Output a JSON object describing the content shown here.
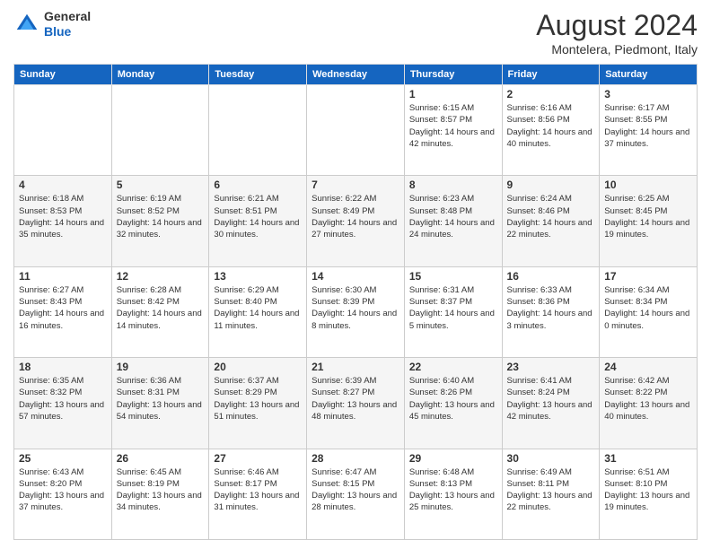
{
  "logo": {
    "line1": "General",
    "line2": "Blue"
  },
  "header": {
    "title": "August 2024",
    "subtitle": "Montelera, Piedmont, Italy"
  },
  "days_of_week": [
    "Sunday",
    "Monday",
    "Tuesday",
    "Wednesday",
    "Thursday",
    "Friday",
    "Saturday"
  ],
  "weeks": [
    [
      {
        "day": "",
        "info": ""
      },
      {
        "day": "",
        "info": ""
      },
      {
        "day": "",
        "info": ""
      },
      {
        "day": "",
        "info": ""
      },
      {
        "day": "1",
        "info": "Sunrise: 6:15 AM\nSunset: 8:57 PM\nDaylight: 14 hours and 42 minutes."
      },
      {
        "day": "2",
        "info": "Sunrise: 6:16 AM\nSunset: 8:56 PM\nDaylight: 14 hours and 40 minutes."
      },
      {
        "day": "3",
        "info": "Sunrise: 6:17 AM\nSunset: 8:55 PM\nDaylight: 14 hours and 37 minutes."
      }
    ],
    [
      {
        "day": "4",
        "info": "Sunrise: 6:18 AM\nSunset: 8:53 PM\nDaylight: 14 hours and 35 minutes."
      },
      {
        "day": "5",
        "info": "Sunrise: 6:19 AM\nSunset: 8:52 PM\nDaylight: 14 hours and 32 minutes."
      },
      {
        "day": "6",
        "info": "Sunrise: 6:21 AM\nSunset: 8:51 PM\nDaylight: 14 hours and 30 minutes."
      },
      {
        "day": "7",
        "info": "Sunrise: 6:22 AM\nSunset: 8:49 PM\nDaylight: 14 hours and 27 minutes."
      },
      {
        "day": "8",
        "info": "Sunrise: 6:23 AM\nSunset: 8:48 PM\nDaylight: 14 hours and 24 minutes."
      },
      {
        "day": "9",
        "info": "Sunrise: 6:24 AM\nSunset: 8:46 PM\nDaylight: 14 hours and 22 minutes."
      },
      {
        "day": "10",
        "info": "Sunrise: 6:25 AM\nSunset: 8:45 PM\nDaylight: 14 hours and 19 minutes."
      }
    ],
    [
      {
        "day": "11",
        "info": "Sunrise: 6:27 AM\nSunset: 8:43 PM\nDaylight: 14 hours and 16 minutes."
      },
      {
        "day": "12",
        "info": "Sunrise: 6:28 AM\nSunset: 8:42 PM\nDaylight: 14 hours and 14 minutes."
      },
      {
        "day": "13",
        "info": "Sunrise: 6:29 AM\nSunset: 8:40 PM\nDaylight: 14 hours and 11 minutes."
      },
      {
        "day": "14",
        "info": "Sunrise: 6:30 AM\nSunset: 8:39 PM\nDaylight: 14 hours and 8 minutes."
      },
      {
        "day": "15",
        "info": "Sunrise: 6:31 AM\nSunset: 8:37 PM\nDaylight: 14 hours and 5 minutes."
      },
      {
        "day": "16",
        "info": "Sunrise: 6:33 AM\nSunset: 8:36 PM\nDaylight: 14 hours and 3 minutes."
      },
      {
        "day": "17",
        "info": "Sunrise: 6:34 AM\nSunset: 8:34 PM\nDaylight: 14 hours and 0 minutes."
      }
    ],
    [
      {
        "day": "18",
        "info": "Sunrise: 6:35 AM\nSunset: 8:32 PM\nDaylight: 13 hours and 57 minutes."
      },
      {
        "day": "19",
        "info": "Sunrise: 6:36 AM\nSunset: 8:31 PM\nDaylight: 13 hours and 54 minutes."
      },
      {
        "day": "20",
        "info": "Sunrise: 6:37 AM\nSunset: 8:29 PM\nDaylight: 13 hours and 51 minutes."
      },
      {
        "day": "21",
        "info": "Sunrise: 6:39 AM\nSunset: 8:27 PM\nDaylight: 13 hours and 48 minutes."
      },
      {
        "day": "22",
        "info": "Sunrise: 6:40 AM\nSunset: 8:26 PM\nDaylight: 13 hours and 45 minutes."
      },
      {
        "day": "23",
        "info": "Sunrise: 6:41 AM\nSunset: 8:24 PM\nDaylight: 13 hours and 42 minutes."
      },
      {
        "day": "24",
        "info": "Sunrise: 6:42 AM\nSunset: 8:22 PM\nDaylight: 13 hours and 40 minutes."
      }
    ],
    [
      {
        "day": "25",
        "info": "Sunrise: 6:43 AM\nSunset: 8:20 PM\nDaylight: 13 hours and 37 minutes."
      },
      {
        "day": "26",
        "info": "Sunrise: 6:45 AM\nSunset: 8:19 PM\nDaylight: 13 hours and 34 minutes."
      },
      {
        "day": "27",
        "info": "Sunrise: 6:46 AM\nSunset: 8:17 PM\nDaylight: 13 hours and 31 minutes."
      },
      {
        "day": "28",
        "info": "Sunrise: 6:47 AM\nSunset: 8:15 PM\nDaylight: 13 hours and 28 minutes."
      },
      {
        "day": "29",
        "info": "Sunrise: 6:48 AM\nSunset: 8:13 PM\nDaylight: 13 hours and 25 minutes."
      },
      {
        "day": "30",
        "info": "Sunrise: 6:49 AM\nSunset: 8:11 PM\nDaylight: 13 hours and 22 minutes."
      },
      {
        "day": "31",
        "info": "Sunrise: 6:51 AM\nSunset: 8:10 PM\nDaylight: 13 hours and 19 minutes."
      }
    ]
  ]
}
